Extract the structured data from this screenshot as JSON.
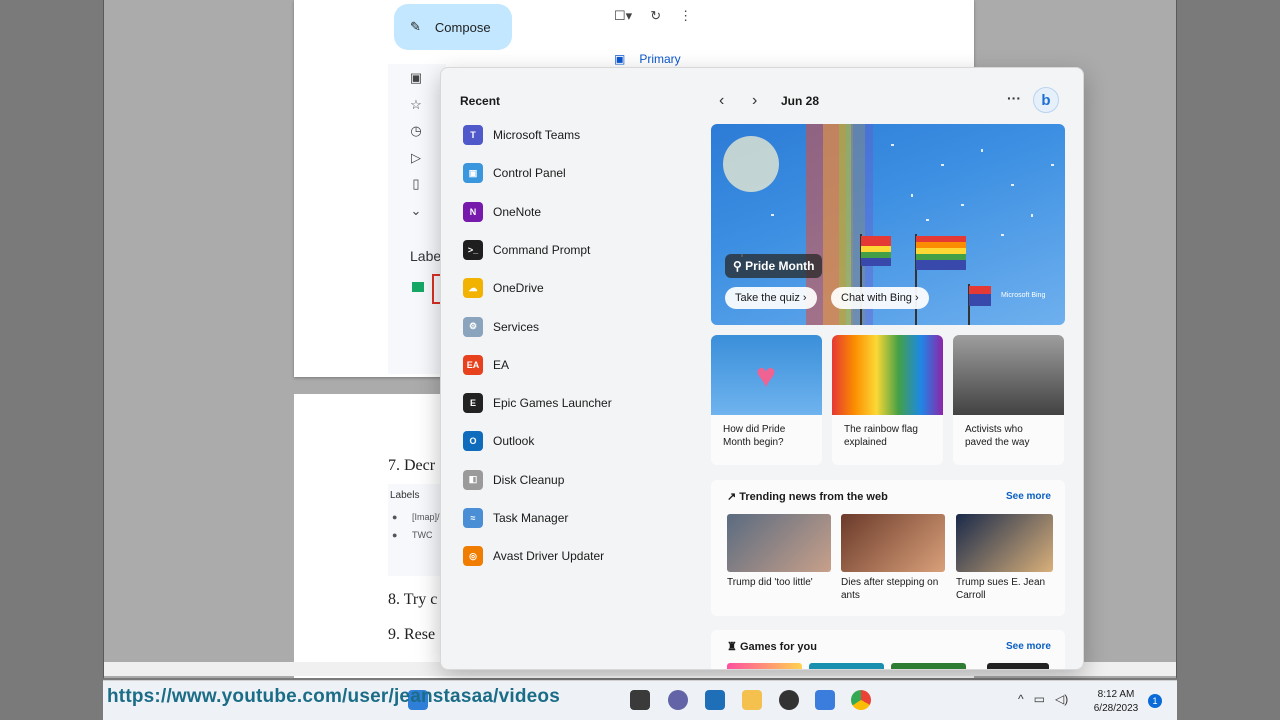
{
  "gmail": {
    "compose_label": "Compose",
    "primary_tab": "Primary",
    "labels_heading": "Labe",
    "nav_icons": [
      "inbox-icon",
      "star-icon",
      "clock-icon",
      "send-icon",
      "draft-icon",
      "chevron-down-icon"
    ]
  },
  "document": {
    "line7": "7. Decr",
    "labels_panel": {
      "title": "Labels",
      "items": [
        "[Imap]/",
        "TWC"
      ]
    },
    "line8": "8. Try c",
    "line9": "9. Rese"
  },
  "recent": {
    "title": "Recent",
    "apps": [
      {
        "label": "Microsoft Teams",
        "icon": "teams-icon",
        "color": "#5059c9",
        "glyph": "T"
      },
      {
        "label": "Control Panel",
        "icon": "control-panel-icon",
        "color": "#3a96dd",
        "glyph": "▣"
      },
      {
        "label": "OneNote",
        "icon": "onenote-icon",
        "color": "#7719aa",
        "glyph": "N"
      },
      {
        "label": "Command Prompt",
        "icon": "command-prompt-icon",
        "color": "#1e1e1e",
        "glyph": ">_"
      },
      {
        "label": "OneDrive",
        "icon": "onedrive-icon",
        "color": "#f2b300",
        "glyph": "☁"
      },
      {
        "label": "Services",
        "icon": "services-icon",
        "color": "#8aa4bd",
        "glyph": "⚙"
      },
      {
        "label": "EA",
        "icon": "ea-icon",
        "color": "#e8411e",
        "glyph": "EA"
      },
      {
        "label": "Epic Games Launcher",
        "icon": "epic-games-icon",
        "color": "#222222",
        "glyph": "E"
      },
      {
        "label": "Outlook",
        "icon": "outlook-icon",
        "color": "#0f6cbd",
        "glyph": "O"
      },
      {
        "label": "Disk Cleanup",
        "icon": "disk-cleanup-icon",
        "color": "#9a9a9a",
        "glyph": "◧"
      },
      {
        "label": "Task Manager",
        "icon": "task-manager-icon",
        "color": "#4a8fd6",
        "glyph": "≈"
      },
      {
        "label": "Avast Driver Updater",
        "icon": "avast-icon",
        "color": "#f07d00",
        "glyph": "◎"
      }
    ]
  },
  "widgets": {
    "date": "Jun 28",
    "hero": {
      "chip": "Pride Month",
      "quiz_btn": "Take the quiz",
      "chat_btn": "Chat with Bing",
      "brand": "Microsoft Bing"
    },
    "cards": [
      {
        "caption": "How did Pride Month begin?"
      },
      {
        "caption": "The rainbow flag explained"
      },
      {
        "caption": "Activists who paved the way"
      }
    ],
    "trending": {
      "title": "Trending news from the web",
      "see_more": "See more",
      "items": [
        {
          "caption": "Trump did 'too little'"
        },
        {
          "caption": "Dies after stepping on ants"
        },
        {
          "caption": "Trump sues E. Jean Carroll"
        }
      ]
    },
    "games": {
      "title": "Games for you",
      "see_more": "See more"
    }
  },
  "taskbar": {
    "overlay_url": "https://www.youtube.com/user/jeanstasaa/videos",
    "time": "8:12 AM",
    "date": "6/28/2023",
    "notification_count": "1"
  }
}
